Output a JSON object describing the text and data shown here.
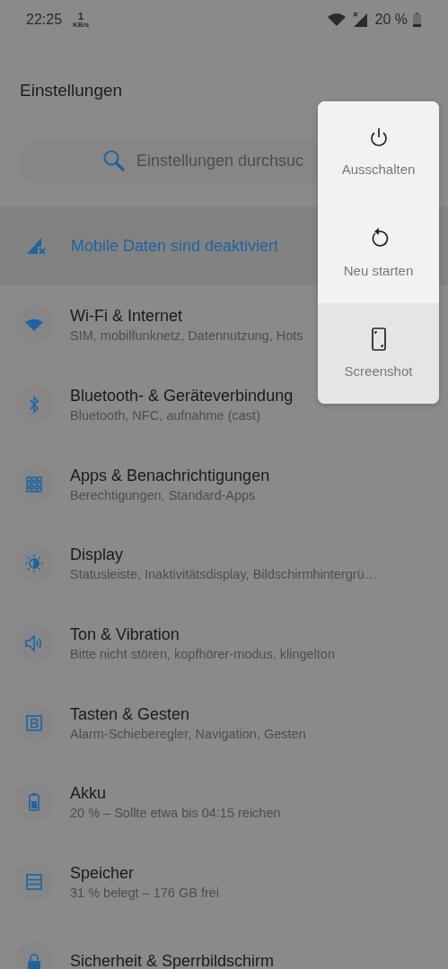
{
  "status_bar": {
    "time": "22:25",
    "speed_value": "1",
    "speed_unit": "KB/s",
    "battery": "20 %"
  },
  "title": "Einstellungen",
  "search": {
    "placeholder": "Einstellungen durchsuc"
  },
  "banner": {
    "text": "Mobile Daten sind deaktiviert"
  },
  "items": [
    {
      "kind": "wifi",
      "title": "Wi-Fi & Internet",
      "subtitle": "SIM, mobilfunknetz, Datennutzung, Hots"
    },
    {
      "kind": "bluetooth",
      "title": "Bluetooth- & Geräteverbindung",
      "subtitle": "Bluetooth, NFC, aufnahme (cast)"
    },
    {
      "kind": "apps",
      "title": "Apps & Benachrichtigungen",
      "subtitle": "Berechtigungen, Standard-Apps"
    },
    {
      "kind": "display",
      "title": "Display",
      "subtitle": "Statusleiste, Inaktivitätsdisplay, Bildschirmhintergrü…"
    },
    {
      "kind": "sound",
      "title": "Ton & Vibration",
      "subtitle": "Bitte nicht stören, kopfhörer-modus, klingelton"
    },
    {
      "kind": "buttons",
      "title": "Tasten & Gesten",
      "subtitle": "Alarm-Schieberegler, Navigation, Gesten"
    },
    {
      "kind": "battery",
      "title": "Akku",
      "subtitle": "20 % – Sollte etwa bis 04:15 reichen"
    },
    {
      "kind": "storage",
      "title": "Speicher",
      "subtitle": "31 % belegt – 176 GB frei"
    },
    {
      "kind": "security",
      "title": "Sicherheit & Sperrbildschirm"
    }
  ],
  "power_menu": [
    {
      "kind": "power",
      "label": "Ausschalten",
      "selected": false
    },
    {
      "kind": "restart",
      "label": "Neu starten",
      "selected": false
    },
    {
      "kind": "screenshot",
      "label": "Screenshot",
      "selected": true
    }
  ]
}
